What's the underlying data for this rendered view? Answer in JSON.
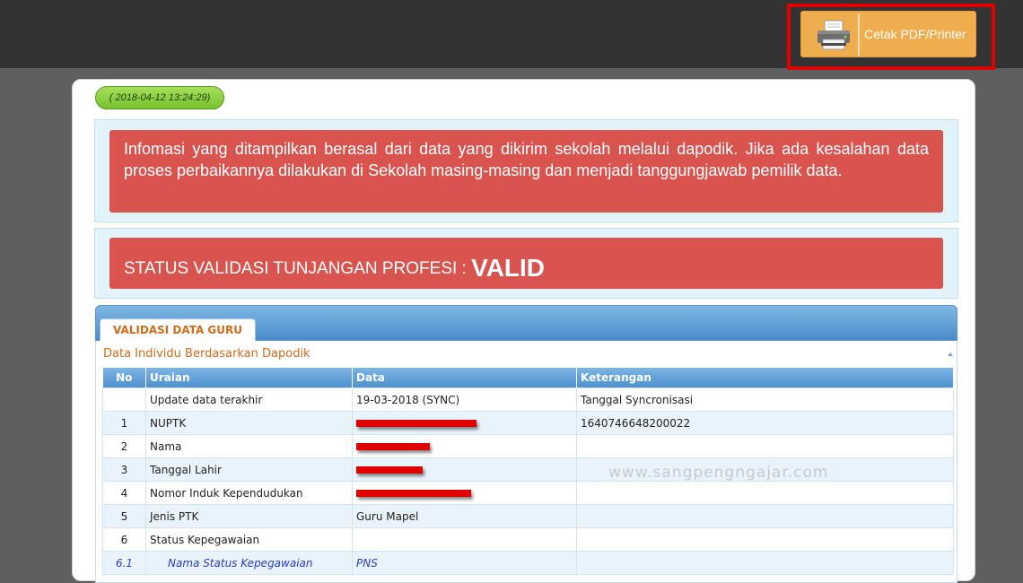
{
  "toolbar": {
    "print_label": "Cetak PDF/Printer",
    "print_icon": "printer-icon",
    "highlight_color": "#e00000"
  },
  "timestamp": "( 2018-04-12 13:24:29)",
  "info_alert": {
    "text": "Infomasi yang ditampilkan berasal dari data yang dikirim sekolah melalui dapodik. Jika ada kesalahan data proses perbaikannya dilakukan di Sekolah masing-masing dan menjadi tanggungjawab pemilik data."
  },
  "status_alert": {
    "label": "STATUS VALIDASI TUNJANGAN PROFESI :",
    "value": "VALID"
  },
  "tab": {
    "label": "VALIDASI DATA GURU"
  },
  "section": {
    "title": "Data Individu Berdasarkan Dapodik",
    "columns": [
      "No",
      "Uraian",
      "Data",
      "Keterangan"
    ],
    "rows": [
      {
        "no": "",
        "uraian": "Update data terakhir",
        "data": "19-03-2018 (SYNC)",
        "keterangan": "Tanggal Syncronisasi"
      },
      {
        "no": "1",
        "uraian": "NUPTK",
        "data": "",
        "keterangan": "1640746648200022"
      },
      {
        "no": "2",
        "uraian": "Nama",
        "data": "",
        "keterangan": ""
      },
      {
        "no": "3",
        "uraian": "Tanggal Lahir",
        "data": "",
        "keterangan": ""
      },
      {
        "no": "4",
        "uraian": "Nomor Induk Kependudukan",
        "data": "",
        "keterangan": ""
      },
      {
        "no": "5",
        "uraian": "Jenis PTK",
        "data": "Guru Mapel",
        "keterangan": ""
      },
      {
        "no": "6",
        "uraian": "Status Kepegawaian",
        "data": "",
        "keterangan": ""
      },
      {
        "no": "6.1",
        "uraian": "Nama Status Kepegawaian",
        "data": "PNS",
        "keterangan": ""
      }
    ]
  },
  "watermark": "www.sangpengngajar.com",
  "colors": {
    "alert_red": "#d9534f",
    "print_button": "#f0ad4e",
    "timestamp_green": "#8fd13f",
    "header_blue": "#4f90cd",
    "accent_orange": "#d06b1a"
  }
}
